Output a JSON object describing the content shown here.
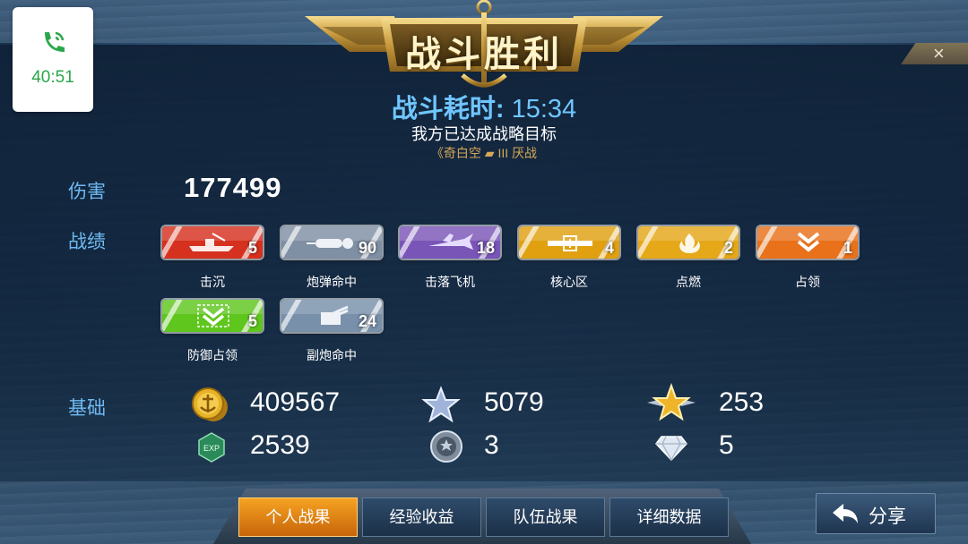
{
  "call_widget": {
    "time": "40:51"
  },
  "banner": {
    "title": "战斗胜利"
  },
  "close": {
    "label": "×"
  },
  "battle": {
    "time_label": "战斗耗时:",
    "time_value": "15:34",
    "objective": "我方已达成战略目标",
    "map_info": "《奇白空 ▰ III 厌战"
  },
  "labels": {
    "damage": "伤害",
    "record": "战绩",
    "base": "基础"
  },
  "damage": "177499",
  "achievements": [
    {
      "name": "击沉",
      "count": "5",
      "color": "#d6301e",
      "icon": "ship-icon"
    },
    {
      "name": "炮弹命中",
      "count": "90",
      "color": "#7f8fa4",
      "icon": "shell-icon"
    },
    {
      "name": "击落飞机",
      "count": "18",
      "color": "#7a55b8",
      "icon": "plane-icon"
    },
    {
      "name": "核心区",
      "count": "4",
      "color": "#e0a010",
      "icon": "core-icon"
    },
    {
      "name": "点燃",
      "count": "2",
      "color": "#e5a818",
      "icon": "fire-icon"
    },
    {
      "name": "占领",
      "count": "1",
      "color": "#e8711a",
      "icon": "capture-icon"
    },
    {
      "name": "防御占领",
      "count": "5",
      "color": "#5fc61e",
      "icon": "defend-icon"
    },
    {
      "name": "副炮命中",
      "count": "24",
      "color": "#7890aa",
      "icon": "secondary-gun-icon"
    }
  ],
  "base": {
    "gold": "409567",
    "silver_star": "5079",
    "gold_star": "253",
    "exp": "2539",
    "medal": "3",
    "diamond": "5"
  },
  "tabs": [
    {
      "label": "个人战果",
      "active": true
    },
    {
      "label": "经验收益",
      "active": false
    },
    {
      "label": "队伍战果",
      "active": false
    },
    {
      "label": "详细数据",
      "active": false
    }
  ],
  "share": {
    "label": "分享"
  }
}
